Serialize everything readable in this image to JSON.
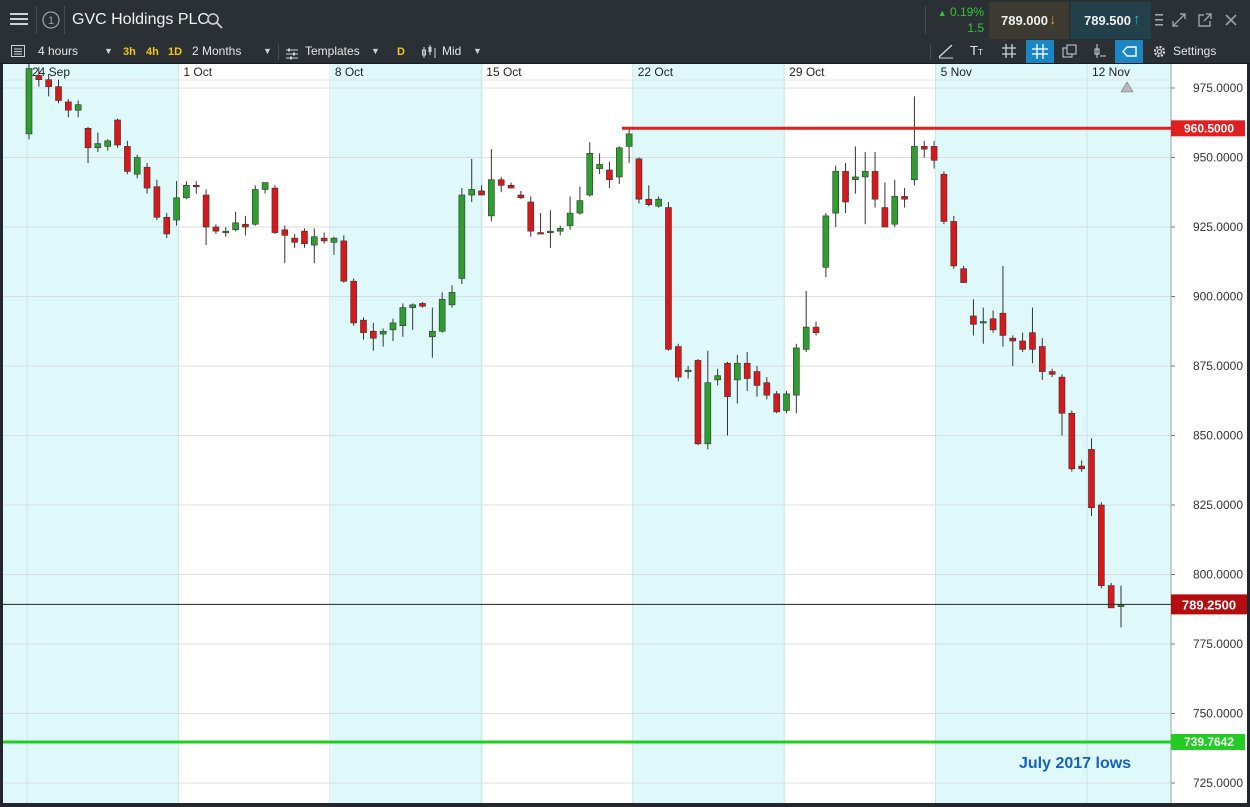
{
  "instrument": "GVC Holdings PLC",
  "change": {
    "percent": "0.19%",
    "points": "1.5"
  },
  "sell_price": "789.000",
  "buy_price": "789.500",
  "toolbar": {
    "interval": "4 hours",
    "quick_intervals": [
      "3h",
      "4h",
      "1D"
    ],
    "range": "2 Months",
    "templates": "Templates",
    "d_button": "D",
    "price_mode": "Mid",
    "text_tool": "T",
    "settings": "Settings"
  },
  "colors": {
    "up": "#2e9e2e",
    "down": "#d7191c",
    "resistance": "#e02020",
    "support": "#22cc22",
    "shade": "#dff9fb"
  },
  "chart_data": {
    "type": "candlestick",
    "x_ticks": [
      "24 Sep",
      "1 Oct",
      "8 Oct",
      "15 Oct",
      "22 Oct",
      "29 Oct",
      "5 Nov",
      "12 Nov"
    ],
    "y_ticks": [
      "975.0000",
      "950.0000",
      "925.0000",
      "900.0000",
      "875.0000",
      "850.0000",
      "825.0000",
      "800.0000",
      "775.0000",
      "750.0000",
      "725.0000"
    ],
    "ylim": [
      722,
      990
    ],
    "current_price": "789.2500",
    "resistance": {
      "label": "960.5000",
      "value": 960.5
    },
    "support": {
      "label": "739.7642",
      "value": 739.7642
    },
    "annotation": "July 2017 lows",
    "candles": [
      {
        "o": 958.5,
        "h": 986.5,
        "l": 956.5,
        "c": 982
      },
      {
        "o": 979.5,
        "h": 982.5,
        "l": 975.5,
        "c": 978
      },
      {
        "o": 978,
        "h": 980,
        "l": 972,
        "c": 975.5
      },
      {
        "o": 975.5,
        "h": 978,
        "l": 969.5,
        "c": 970.5
      },
      {
        "o": 970,
        "h": 971,
        "l": 964.5,
        "c": 967
      },
      {
        "o": 967,
        "h": 970.5,
        "l": 964.5,
        "c": 969
      },
      {
        "o": 960.5,
        "h": 961,
        "l": 948,
        "c": 953.5
      },
      {
        "o": 953.5,
        "h": 959,
        "l": 952,
        "c": 955
      },
      {
        "o": 954,
        "h": 956.5,
        "l": 952.5,
        "c": 956
      },
      {
        "o": 963.5,
        "h": 964,
        "l": 953.5,
        "c": 954.5
      },
      {
        "o": 954,
        "h": 956,
        "l": 944,
        "c": 945
      },
      {
        "o": 944,
        "h": 951,
        "l": 942.5,
        "c": 950
      },
      {
        "o": 946.5,
        "h": 948,
        "l": 937,
        "c": 939
      },
      {
        "o": 939.5,
        "h": 942,
        "l": 927.5,
        "c": 928.5
      },
      {
        "o": 928.5,
        "h": 930,
        "l": 921,
        "c": 922.5
      },
      {
        "o": 927.5,
        "h": 941.5,
        "l": 925.5,
        "c": 935.5
      },
      {
        "o": 935.5,
        "h": 941.5,
        "l": 935,
        "c": 940
      },
      {
        "o": 940,
        "h": 941.5,
        "l": 937,
        "c": 939.5
      },
      {
        "o": 936.5,
        "h": 938.5,
        "l": 918.5,
        "c": 925
      },
      {
        "o": 925,
        "h": 926,
        "l": 922.5,
        "c": 923.5
      },
      {
        "o": 923,
        "h": 925,
        "l": 921.5,
        "c": 923.5
      },
      {
        "o": 924,
        "h": 930.5,
        "l": 923.5,
        "c": 926.5
      },
      {
        "o": 926,
        "h": 929,
        "l": 922,
        "c": 925
      },
      {
        "o": 926,
        "h": 940,
        "l": 925.5,
        "c": 938.5
      },
      {
        "o": 938.5,
        "h": 941,
        "l": 937,
        "c": 941
      },
      {
        "o": 939,
        "h": 940,
        "l": 922.5,
        "c": 923
      },
      {
        "o": 924,
        "h": 925.5,
        "l": 912,
        "c": 922
      },
      {
        "o": 921,
        "h": 922.5,
        "l": 917.5,
        "c": 919.5
      },
      {
        "o": 923.5,
        "h": 924.5,
        "l": 917.5,
        "c": 919
      },
      {
        "o": 918.5,
        "h": 924.5,
        "l": 912,
        "c": 921.5
      },
      {
        "o": 921,
        "h": 923,
        "l": 919,
        "c": 920
      },
      {
        "o": 919.5,
        "h": 921.5,
        "l": 915,
        "c": 921
      },
      {
        "o": 920,
        "h": 922,
        "l": 905,
        "c": 905.5
      },
      {
        "o": 905.5,
        "h": 906.5,
        "l": 889.5,
        "c": 890.5
      },
      {
        "o": 891.5,
        "h": 892.5,
        "l": 884.5,
        "c": 887
      },
      {
        "o": 887.5,
        "h": 890.5,
        "l": 880.5,
        "c": 885
      },
      {
        "o": 886.5,
        "h": 888.5,
        "l": 882,
        "c": 887.5
      },
      {
        "o": 888,
        "h": 892,
        "l": 884,
        "c": 890.5
      },
      {
        "o": 889.5,
        "h": 897.5,
        "l": 885.5,
        "c": 896
      },
      {
        "o": 896,
        "h": 897.5,
        "l": 888,
        "c": 897
      },
      {
        "o": 897.5,
        "h": 898,
        "l": 896,
        "c": 896.5
      },
      {
        "o": 885.5,
        "h": 896,
        "l": 878,
        "c": 887.5
      },
      {
        "o": 887.5,
        "h": 901.5,
        "l": 887,
        "c": 899
      },
      {
        "o": 897,
        "h": 904,
        "l": 896,
        "c": 901.5
      },
      {
        "o": 906.5,
        "h": 939,
        "l": 904.5,
        "c": 936.5
      },
      {
        "o": 936.5,
        "h": 949.5,
        "l": 934,
        "c": 938.5
      },
      {
        "o": 938,
        "h": 940,
        "l": 936.5,
        "c": 936.5
      },
      {
        "o": 929,
        "h": 953,
        "l": 927,
        "c": 942
      },
      {
        "o": 942,
        "h": 943,
        "l": 937.5,
        "c": 940
      },
      {
        "o": 940,
        "h": 941,
        "l": 939,
        "c": 939
      },
      {
        "o": 936.5,
        "h": 938,
        "l": 935,
        "c": 935.5
      },
      {
        "o": 934,
        "h": 936,
        "l": 921.5,
        "c": 923.5
      },
      {
        "o": 923,
        "h": 930,
        "l": 922.5,
        "c": 922.5
      },
      {
        "o": 923,
        "h": 931,
        "l": 917.5,
        "c": 923.5
      },
      {
        "o": 923.5,
        "h": 925.5,
        "l": 922,
        "c": 924.5
      },
      {
        "o": 925.5,
        "h": 936,
        "l": 924,
        "c": 930
      },
      {
        "o": 930,
        "h": 939.5,
        "l": 929.5,
        "c": 934.5
      },
      {
        "o": 936.5,
        "h": 955.5,
        "l": 936,
        "c": 951.5
      },
      {
        "o": 946,
        "h": 951.5,
        "l": 944,
        "c": 947.5
      },
      {
        "o": 945.5,
        "h": 948.5,
        "l": 939,
        "c": 942
      },
      {
        "o": 943,
        "h": 954,
        "l": 940.5,
        "c": 953.5
      },
      {
        "o": 954,
        "h": 960.5,
        "l": 948,
        "c": 958.5
      },
      {
        "o": 949.5,
        "h": 950,
        "l": 933.5,
        "c": 935
      },
      {
        "o": 935,
        "h": 940,
        "l": 932.5,
        "c": 933
      },
      {
        "o": 932.5,
        "h": 936,
        "l": 932,
        "c": 935
      },
      {
        "o": 932,
        "h": 934,
        "l": 880.5,
        "c": 881
      },
      {
        "o": 882,
        "h": 883,
        "l": 869.5,
        "c": 871
      },
      {
        "o": 873,
        "h": 875,
        "l": 870.5,
        "c": 873.5
      },
      {
        "o": 877,
        "h": 877.5,
        "l": 846.5,
        "c": 847
      },
      {
        "o": 847,
        "h": 880.5,
        "l": 845,
        "c": 869
      },
      {
        "o": 870,
        "h": 874,
        "l": 868,
        "c": 871.5
      },
      {
        "o": 876,
        "h": 876.5,
        "l": 850,
        "c": 864
      },
      {
        "o": 870,
        "h": 879,
        "l": 861.5,
        "c": 876
      },
      {
        "o": 876,
        "h": 880,
        "l": 866,
        "c": 870.5
      },
      {
        "o": 873,
        "h": 875,
        "l": 864,
        "c": 868
      },
      {
        "o": 869,
        "h": 871,
        "l": 863,
        "c": 864.5
      },
      {
        "o": 865,
        "h": 866,
        "l": 858,
        "c": 858.5
      },
      {
        "o": 859,
        "h": 866,
        "l": 858,
        "c": 865
      },
      {
        "o": 864.5,
        "h": 883,
        "l": 858,
        "c": 881.5
      },
      {
        "o": 881,
        "h": 902,
        "l": 880,
        "c": 889
      },
      {
        "o": 889,
        "h": 891,
        "l": 886,
        "c": 887
      },
      {
        "o": 910.5,
        "h": 930,
        "l": 907,
        "c": 929
      },
      {
        "o": 930,
        "h": 947,
        "l": 925,
        "c": 945
      },
      {
        "o": 945,
        "h": 948,
        "l": 930,
        "c": 934
      },
      {
        "o": 942,
        "h": 954,
        "l": 937,
        "c": 943
      },
      {
        "o": 943,
        "h": 952,
        "l": 926,
        "c": 945
      },
      {
        "o": 945,
        "h": 952,
        "l": 932,
        "c": 935
      },
      {
        "o": 932,
        "h": 941,
        "l": 926,
        "c": 925
      },
      {
        "o": 926,
        "h": 942,
        "l": 925,
        "c": 936
      },
      {
        "o": 936,
        "h": 939,
        "l": 932,
        "c": 935
      },
      {
        "o": 942,
        "h": 972,
        "l": 940,
        "c": 954
      },
      {
        "o": 954,
        "h": 956,
        "l": 950,
        "c": 953
      },
      {
        "o": 954,
        "h": 956,
        "l": 946,
        "c": 949
      },
      {
        "o": 944,
        "h": 945,
        "l": 926,
        "c": 927
      },
      {
        "o": 927,
        "h": 929,
        "l": 910,
        "c": 911
      },
      {
        "o": 910,
        "h": 911,
        "l": 905,
        "c": 905
      },
      {
        "o": 893,
        "h": 899,
        "l": 886,
        "c": 890
      },
      {
        "o": 891,
        "h": 896,
        "l": 883,
        "c": 891
      },
      {
        "o": 892,
        "h": 895,
        "l": 887,
        "c": 888
      },
      {
        "o": 894,
        "h": 911,
        "l": 882,
        "c": 886
      },
      {
        "o": 885,
        "h": 886,
        "l": 875,
        "c": 884
      },
      {
        "o": 884,
        "h": 887,
        "l": 880,
        "c": 881
      },
      {
        "o": 887,
        "h": 896,
        "l": 876,
        "c": 881
      },
      {
        "o": 882,
        "h": 885,
        "l": 870,
        "c": 873
      },
      {
        "o": 873,
        "h": 874,
        "l": 871,
        "c": 872
      },
      {
        "o": 871,
        "h": 872,
        "l": 850,
        "c": 858
      },
      {
        "o": 858,
        "h": 859,
        "l": 837,
        "c": 838
      },
      {
        "o": 839,
        "h": 841,
        "l": 837,
        "c": 838
      },
      {
        "o": 845,
        "h": 849,
        "l": 821,
        "c": 824
      },
      {
        "o": 825,
        "h": 826,
        "l": 795,
        "c": 796
      },
      {
        "o": 796,
        "h": 797,
        "l": 788,
        "c": 788
      },
      {
        "o": 789,
        "h": 796,
        "l": 781,
        "c": 789
      }
    ]
  }
}
